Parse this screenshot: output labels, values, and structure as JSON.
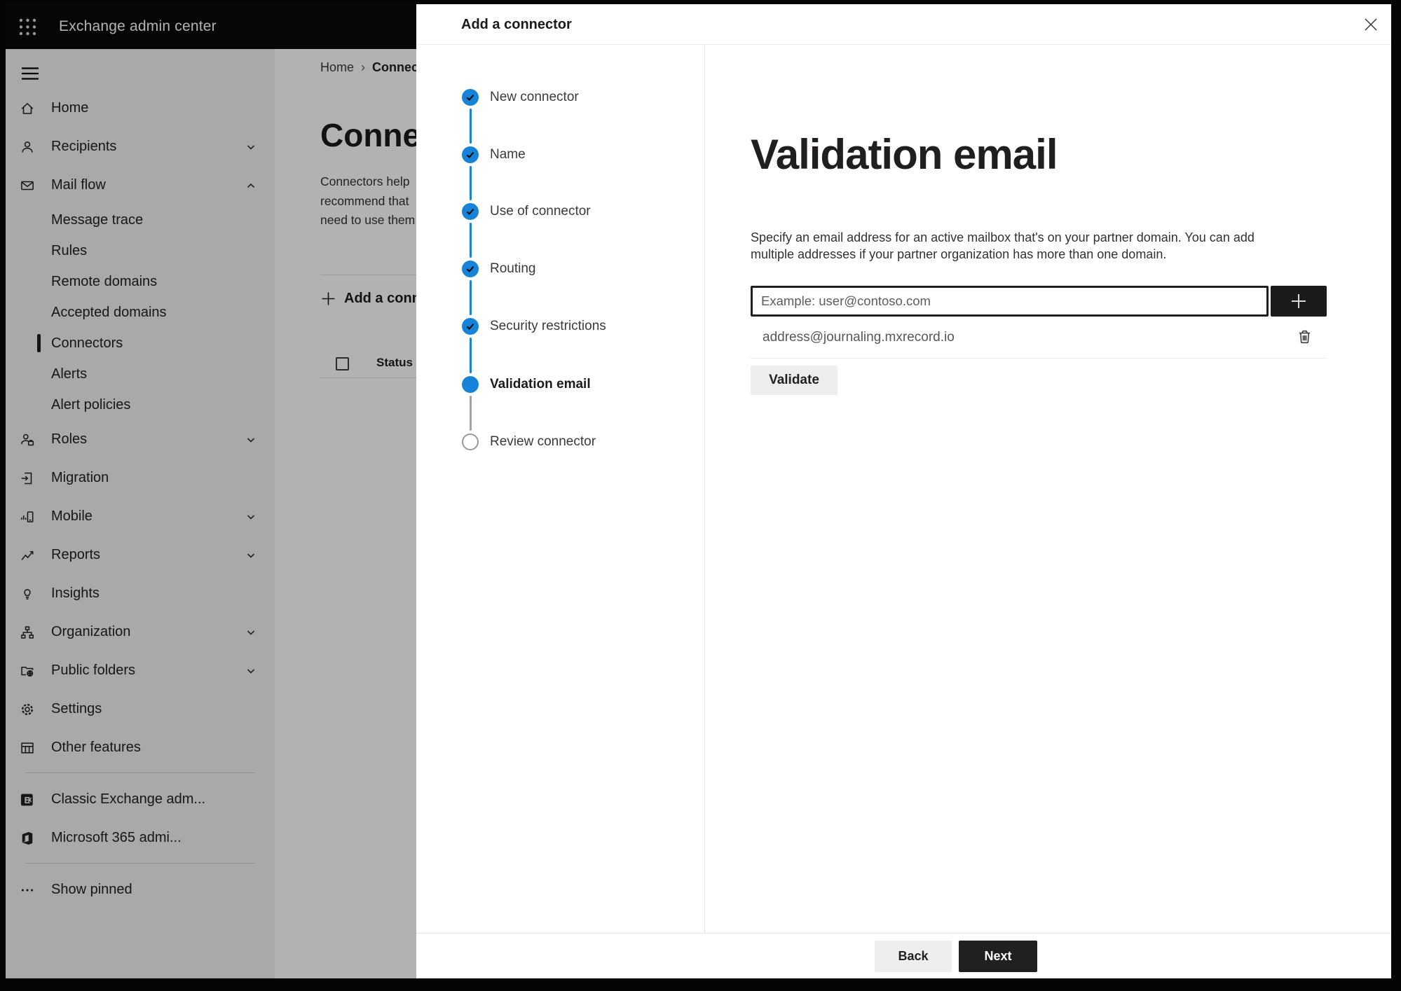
{
  "topbar": {
    "title": "Exchange admin center"
  },
  "sidebar": {
    "items": [
      {
        "label": "Home"
      },
      {
        "label": "Recipients",
        "chevron": "down"
      },
      {
        "label": "Mail flow",
        "chevron": "up",
        "expanded": true
      },
      {
        "label": "Message trace",
        "level": "sub"
      },
      {
        "label": "Rules",
        "level": "sub"
      },
      {
        "label": "Remote domains",
        "level": "sub"
      },
      {
        "label": "Accepted domains",
        "level": "sub"
      },
      {
        "label": "Connectors",
        "level": "sub",
        "selected": true
      },
      {
        "label": "Alerts",
        "level": "sub"
      },
      {
        "label": "Alert policies",
        "level": "sub"
      },
      {
        "label": "Roles",
        "chevron": "down"
      },
      {
        "label": "Migration"
      },
      {
        "label": "Mobile",
        "chevron": "down"
      },
      {
        "label": "Reports",
        "chevron": "down"
      },
      {
        "label": "Insights"
      },
      {
        "label": "Organization",
        "chevron": "down"
      },
      {
        "label": "Public folders",
        "chevron": "down"
      },
      {
        "label": "Settings"
      },
      {
        "label": "Other features"
      }
    ],
    "footer_items": [
      {
        "label": "Classic Exchange adm..."
      },
      {
        "label": "Microsoft 365 admi..."
      }
    ],
    "show_pinned": {
      "label": "Show pinned"
    }
  },
  "main": {
    "breadcrumb": {
      "home": "Home",
      "current": "Connectors",
      "separator": "›"
    },
    "title": "Connectors",
    "description_lines": [
      "Connectors help",
      "recommend that",
      "need to use them"
    ],
    "add_button_label": "Add a connector",
    "table": {
      "column_status": "Status"
    }
  },
  "panel": {
    "title": "Add a connector",
    "steps": [
      {
        "label": "New connector",
        "state": "completed"
      },
      {
        "label": "Name",
        "state": "completed"
      },
      {
        "label": "Use of connector",
        "state": "completed"
      },
      {
        "label": "Routing",
        "state": "completed"
      },
      {
        "label": "Security restrictions",
        "state": "completed"
      },
      {
        "label": "Validation email",
        "state": "current"
      },
      {
        "label": "Review connector",
        "state": "upcoming"
      }
    ],
    "content": {
      "heading": "Validation email",
      "description_lines": [
        "Specify an email address for an active mailbox that's on your partner domain. You can add",
        "multiple addresses if your partner organization has more than one domain."
      ],
      "email_input": {
        "value": "",
        "placeholder": "Example: user@contoso.com"
      },
      "addresses": [
        {
          "email": "address@journaling.mxrecord.io"
        }
      ],
      "validate_button": "Validate"
    },
    "footer": {
      "back_button": "Back",
      "next_button": "Next"
    }
  },
  "icons": {
    "app-launcher": "3x3 dot grid",
    "menu": "hamburger",
    "close": "✕",
    "add": "+",
    "delete": "trash",
    "check": "✓",
    "chevron-down": "⌄",
    "chevron-up": "⌃",
    "breadcrumb-separator": "›"
  },
  "colors": {
    "accent_blue": "#1783d8",
    "topbar_bg": "#0b0a0a",
    "sidebar_bg": "#f3f2f1",
    "dark_button": "#21201f",
    "light_button": "#efeeed",
    "dim_overlay": "rgba(0,0,0,0.30)",
    "input_border": "#201f1e"
  }
}
